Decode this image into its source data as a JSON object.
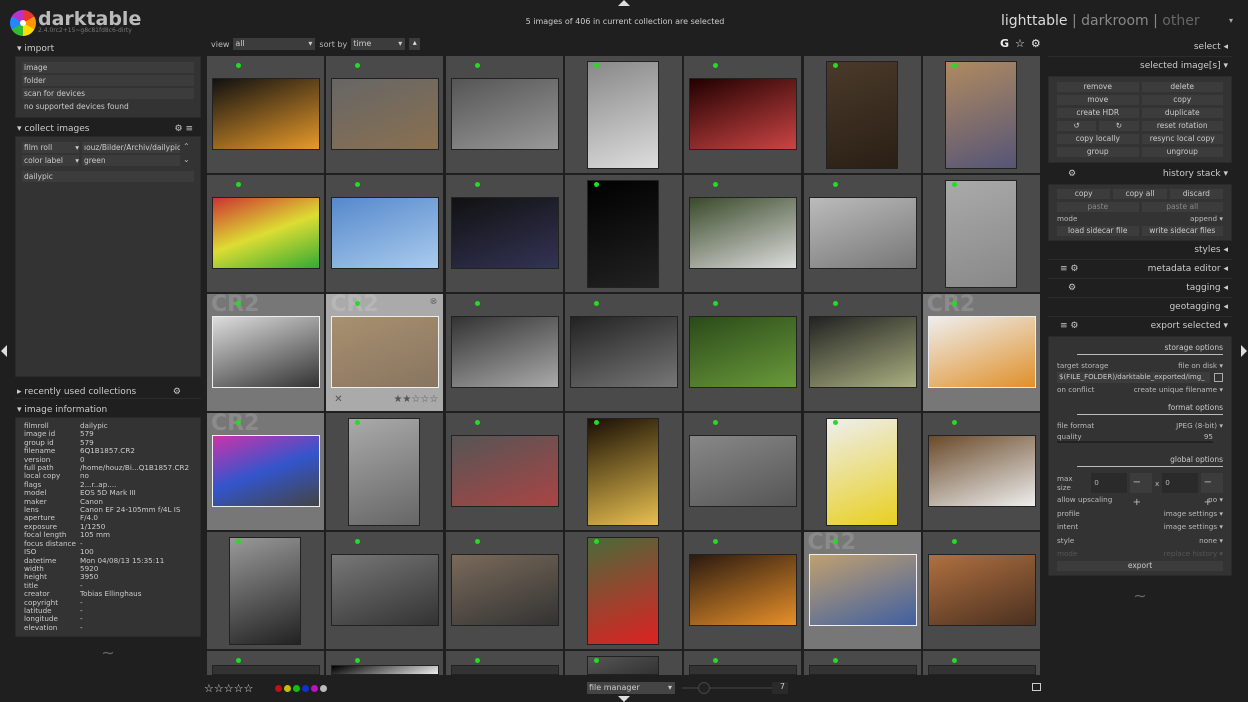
{
  "app": {
    "name": "darktable",
    "version": "2.4.0rc2+15~g8c81fd8c6-dirty"
  },
  "top": {
    "status": "5 images of 406 in current collection are selected",
    "view_label": "view",
    "view_value": "all",
    "sort_label": "sort by",
    "sort_value": "time",
    "views": [
      "lighttable",
      "darkroom",
      "other"
    ],
    "separator": "|",
    "icons": [
      "G",
      "☆",
      "⚙"
    ]
  },
  "left": {
    "import": {
      "title": "import",
      "items": [
        "image",
        "folder",
        "scan for devices",
        "no supported devices found"
      ]
    },
    "collect": {
      "title": "collect images",
      "rules": [
        {
          "property": "film roll",
          "value": "ıouz/Bilder/Archiv/dailypic"
        },
        {
          "property": "color label",
          "value": "green"
        }
      ],
      "list": [
        "dailypic"
      ]
    },
    "recent": {
      "title": "recently used collections"
    },
    "info": {
      "title": "image information",
      "rows": [
        [
          "filmroll",
          "dailypic"
        ],
        [
          "image id",
          "579"
        ],
        [
          "group id",
          "579"
        ],
        [
          "filename",
          "6Q1B1857.CR2"
        ],
        [
          "version",
          "0"
        ],
        [
          "full path",
          "/home/houz/Bi...Q1B1857.CR2"
        ],
        [
          "local copy",
          "no"
        ],
        [
          "flags",
          "2...r..ap...."
        ],
        [
          "model",
          "EOS 5D Mark III"
        ],
        [
          "maker",
          "Canon"
        ],
        [
          "lens",
          "Canon EF 24-105mm f/4L IS"
        ],
        [
          "aperture",
          "F/4.0"
        ],
        [
          "exposure",
          "1/1250"
        ],
        [
          "focal length",
          "105 mm"
        ],
        [
          "focus distance",
          "-"
        ],
        [
          "ISO",
          "100"
        ],
        [
          "datetime",
          "Mon 04/08/13 15:35:11"
        ],
        [
          "width",
          "5920"
        ],
        [
          "height",
          "3950"
        ],
        [
          "title",
          "-"
        ],
        [
          "creator",
          "Tobias Ellinghaus"
        ],
        [
          "copyright",
          "-"
        ],
        [
          "latitude",
          "-"
        ],
        [
          "longitude",
          "-"
        ],
        [
          "elevation",
          "-"
        ]
      ]
    }
  },
  "right": {
    "select": "select",
    "selected": {
      "title": "selected image[s]",
      "buttons": [
        "remove",
        "delete",
        "move",
        "copy",
        "create HDR",
        "duplicate",
        "↺",
        "↻",
        "reset rotation",
        "copy locally",
        "resync local copy",
        "group",
        "ungroup"
      ]
    },
    "history": {
      "title": "history stack",
      "buttons": [
        "copy",
        "copy all",
        "discard",
        "paste",
        "paste all"
      ],
      "mode_label": "mode",
      "mode_value": "append",
      "load": "load sidecar file",
      "write": "write sidecar files"
    },
    "styles": "styles",
    "metadata": "metadata editor",
    "tagging": "tagging",
    "geotagging": "geotagging",
    "export": {
      "title": "export selected",
      "storage_options": "storage options",
      "target_storage_label": "target storage",
      "target_storage": "file on disk",
      "path": "$(FILE_FOLDER)/darktable_exported/img_",
      "on_conflict_label": "on conflict",
      "on_conflict": "create unique filename",
      "format_options": "format options",
      "file_format_label": "file format",
      "file_format": "JPEG (8-bit)",
      "quality_label": "quality",
      "quality": "95",
      "global_options": "global options",
      "max_size_label": "max size",
      "max_w": "0",
      "max_h": "0",
      "x": "x",
      "upscaling_label": "allow upscaling",
      "upscaling": "no",
      "profile_label": "profile",
      "profile": "image settings",
      "intent_label": "intent",
      "intent": "image settings",
      "style_label": "style",
      "style": "none",
      "mode_label": "mode",
      "mode": "replace history",
      "export_button": "export"
    }
  },
  "bottom": {
    "stars": "☆☆☆☆☆",
    "color_labels": [
      "#c01010",
      "#c0c010",
      "#10c010",
      "#1030d0",
      "#c010c0",
      "#bbbbbb"
    ],
    "layout": "file manager",
    "zoom": "7"
  },
  "grid": {
    "watermark": "CR2",
    "label_color": "#22dd22",
    "hover_rating": 2,
    "thumbs": [
      {
        "o": "l",
        "c": [
          "#111",
          "#e89a2a"
        ]
      },
      {
        "o": "l",
        "c": [
          "#666",
          "#8a7050"
        ]
      },
      {
        "o": "l",
        "c": [
          "#555",
          "#999"
        ]
      },
      {
        "o": "p",
        "c": [
          "#888",
          "#ddd"
        ]
      },
      {
        "o": "l",
        "c": [
          "#200",
          "#c44"
        ]
      },
      {
        "o": "p",
        "c": [
          "#4a3a2a",
          "#2a1f15"
        ]
      },
      {
        "o": "p",
        "c": [
          "#b08a60",
          "#557"
        ]
      },
      {
        "o": "l",
        "c": [
          "#c33",
          "#dd3",
          "#3a3"
        ]
      },
      {
        "o": "l",
        "c": [
          "#5588cc",
          "#aaccee"
        ]
      },
      {
        "o": "l",
        "c": [
          "#111",
          "#335"
        ]
      },
      {
        "o": "p",
        "c": [
          "#000",
          "#222"
        ]
      },
      {
        "o": "l",
        "c": [
          "#3a4a2a",
          "#ddd"
        ]
      },
      {
        "o": "l",
        "c": [
          "#bbb",
          "#777"
        ]
      },
      {
        "o": "p",
        "c": [
          "#aaa",
          "#888"
        ]
      },
      {
        "o": "l",
        "c": [
          "#ddd",
          "#333"
        ],
        "s": 1
      },
      {
        "o": "l",
        "c": [
          "#a89070",
          "#887560"
        ],
        "s": 2
      },
      {
        "o": "l",
        "c": [
          "#333",
          "#aaa"
        ]
      },
      {
        "o": "l",
        "c": [
          "#222",
          "#777"
        ]
      },
      {
        "o": "l",
        "c": [
          "#2a4a1a",
          "#6a9a3a"
        ]
      },
      {
        "o": "l",
        "c": [
          "#222",
          "#aab080"
        ]
      },
      {
        "o": "l",
        "c": [
          "#eee",
          "#e0902a"
        ],
        "s": 1
      },
      {
        "o": "l",
        "c": [
          "#c3a",
          "#35c",
          "#444"
        ],
        "s": 1
      },
      {
        "o": "p",
        "c": [
          "#aaa",
          "#666"
        ]
      },
      {
        "o": "l",
        "c": [
          "#555",
          "#a44"
        ]
      },
      {
        "o": "p",
        "c": [
          "#1a1005",
          "#e8c050"
        ]
      },
      {
        "o": "l",
        "c": [
          "#888",
          "#555"
        ]
      },
      {
        "o": "p",
        "c": [
          "#eee",
          "#e8d020"
        ]
      },
      {
        "o": "l",
        "c": [
          "#6a4a2a",
          "#eee"
        ]
      },
      {
        "o": "p",
        "c": [
          "#999",
          "#222"
        ]
      },
      {
        "o": "l",
        "c": [
          "#777",
          "#333"
        ]
      },
      {
        "o": "l",
        "c": [
          "#7a6a5a",
          "#333"
        ]
      },
      {
        "o": "p",
        "c": [
          "#4a6a3a",
          "#dd2222"
        ]
      },
      {
        "o": "l",
        "c": [
          "#2a1a10",
          "#e8902a"
        ]
      },
      {
        "o": "l",
        "c": [
          "#c0a070",
          "#4060a0"
        ],
        "s": 1
      },
      {
        "o": "l",
        "c": [
          "#b07040",
          "#4a3020"
        ]
      },
      {
        "o": "l",
        "c": [
          "#333",
          "#333"
        ]
      },
      {
        "o": "l",
        "c": [
          "#000",
          "#eee"
        ]
      },
      {
        "o": "l",
        "c": [
          "#333",
          "#333"
        ]
      },
      {
        "o": "p",
        "c": [
          "#555",
          "#333"
        ]
      },
      {
        "o": "l",
        "c": [
          "#333",
          "#333"
        ]
      },
      {
        "o": "l",
        "c": [
          "#333",
          "#333"
        ]
      },
      {
        "o": "l",
        "c": [
          "#333",
          "#333"
        ]
      }
    ]
  }
}
